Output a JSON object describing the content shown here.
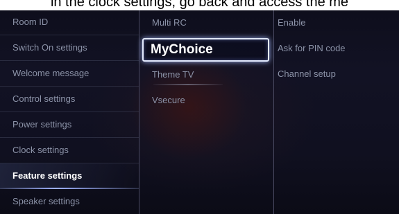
{
  "caption": "in the clock settings, go back and access the me",
  "menu": {
    "column1": [
      {
        "label": "Room ID",
        "active": false
      },
      {
        "label": "Switch On settings",
        "active": false
      },
      {
        "label": "Welcome message",
        "active": false
      },
      {
        "label": "Control settings",
        "active": false
      },
      {
        "label": "Power settings",
        "active": false
      },
      {
        "label": "Clock settings",
        "active": false
      },
      {
        "label": "Feature settings",
        "active": true
      },
      {
        "label": "Speaker settings",
        "active": false
      }
    ],
    "column2": [
      {
        "label": "Multi RC",
        "focused": false
      },
      {
        "label": "MyChoice",
        "focused": true
      },
      {
        "label": "Theme TV",
        "focused": false
      },
      {
        "label": "Vsecure",
        "focused": false
      }
    ],
    "column3": [
      {
        "label": "Enable"
      },
      {
        "label": "Ask for PIN code"
      },
      {
        "label": "Channel setup"
      }
    ]
  }
}
